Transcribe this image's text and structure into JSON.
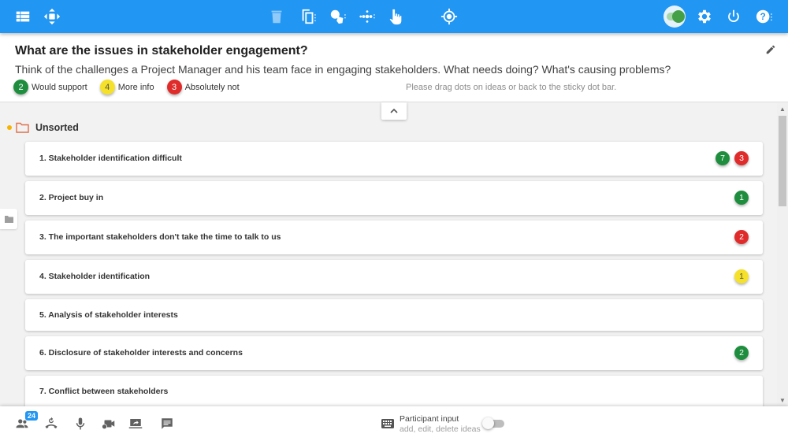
{
  "toolbar": {
    "left_icons": [
      "list-view-icon",
      "move-icon"
    ],
    "center_icons": [
      "delete-icon",
      "duplicate-icon",
      "merge-icon",
      "spread-icon",
      "touch-icon",
      "focus-icon"
    ],
    "right_icons": [
      "presenter-toggle",
      "settings-icon",
      "power-icon",
      "help-icon"
    ],
    "presenter_toggle_on": true,
    "accent_color": "#2196f3"
  },
  "header": {
    "title": "What are the issues in stakeholder engagement?",
    "description": "Think of the challenges a Project Manager and his team face in engaging stakeholders. What needs doing? What's causing problems?",
    "hint": "Please drag dots on ideas or back to the sticky dot bar.",
    "legend": [
      {
        "count": "2",
        "label": "Would support",
        "color": "#1e8e3e"
      },
      {
        "count": "4",
        "label": "More info",
        "color": "#f5e12a"
      },
      {
        "count": "3",
        "label": "Absolutely not",
        "color": "#e02b2b"
      }
    ]
  },
  "group": {
    "label": "Unsorted",
    "items": [
      {
        "text": "1. Stakeholder identification difficult",
        "votes": [
          {
            "count": "7",
            "type": "green"
          },
          {
            "count": "3",
            "type": "red"
          }
        ]
      },
      {
        "text": "2. Project buy in",
        "votes": [
          {
            "count": "1",
            "type": "green"
          }
        ]
      },
      {
        "text": "3. The important stakeholders don't take the time to talk to us",
        "votes": [
          {
            "count": "2",
            "type": "red"
          }
        ]
      },
      {
        "text": "4. Stakeholder identification",
        "votes": [
          {
            "count": "1",
            "type": "yellow"
          }
        ]
      },
      {
        "text": "5. Analysis of stakeholder interests",
        "votes": []
      },
      {
        "text": "6. Disclosure of stakeholder interests and concerns",
        "votes": [
          {
            "count": "2",
            "type": "green"
          }
        ]
      },
      {
        "text": "7. Conflict between stakeholders",
        "votes": []
      }
    ]
  },
  "bottombar": {
    "participants_count": "24",
    "participant_input_title": "Participant input",
    "participant_input_sub": "add, edit, delete ideas",
    "participant_input_on": false
  }
}
